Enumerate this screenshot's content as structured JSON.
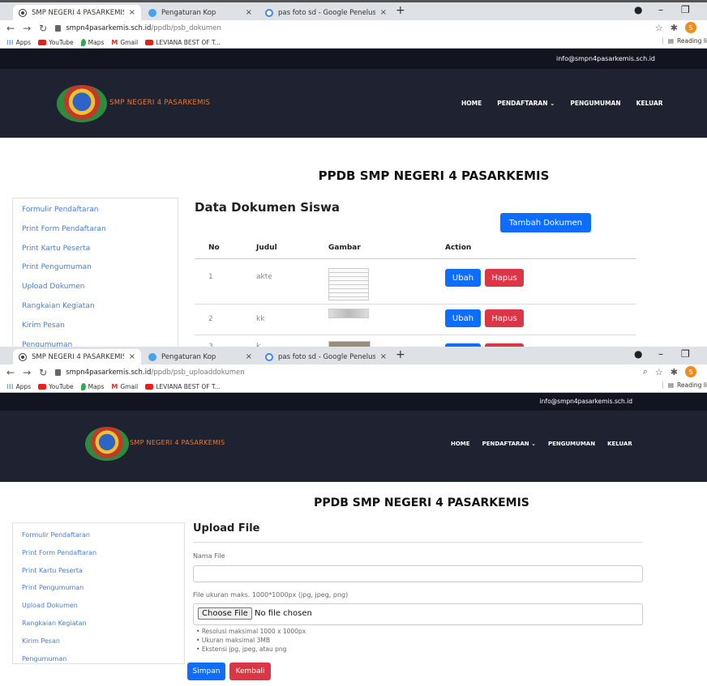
{
  "browser": {
    "tabs": [
      {
        "title": "SMP NEGERI 4 PASARKEMIS"
      },
      {
        "title": "Pengaturan Kop"
      },
      {
        "title": "pas foto sd - Google Penelusuran"
      }
    ],
    "close_glyph": "×",
    "new_tab_glyph": "+",
    "bookmarks": [
      "Apps",
      "YouTube",
      "Maps",
      "Gmail",
      "LEVIANA BEST OF T..."
    ],
    "reading_list": "Reading li",
    "profile_initial": "S",
    "icons": [
      "back-arrow-icon",
      "forward-arrow-icon",
      "reload-icon",
      "lock-icon",
      "star-icon",
      "extensions-icon",
      "profile-avatar-icon",
      "reading-list-icon"
    ]
  },
  "screen1": {
    "url_host": "smpn4pasarkemis.sch.id",
    "url_path": "/ppdb/psb_dokumen"
  },
  "screen2": {
    "url_host": "smpn4pasarkemis.sch.id",
    "url_path": "/ppdb/psb_uploaddokumen"
  },
  "site": {
    "email": "info@smpn4pasarkemis.sch.id",
    "brand": "SMP NEGERI 4 PASARKEMIS",
    "nav": [
      "HOME",
      "PENDAFTARAN ⌄",
      "PENGUMUMAN",
      "KELUAR"
    ],
    "page_heading": "PPDB SMP NEGERI 4 PASARKEMIS",
    "sidebar": [
      "Formulir Pendaftaran",
      "Print Form Pendaftaran",
      "Print Kartu Peserta",
      "Print Pengumuman",
      "Upload Dokumen",
      "Rangkaian Kegiatan",
      "Kirim Pesan",
      "Pengumuman"
    ],
    "accent_orange": "#f07a2a",
    "link_blue": "#4a7ec9",
    "btn_blue": "#0d6efd",
    "btn_red": "#dc3545"
  },
  "dokumen": {
    "title": "Data Dokumen Siswa",
    "add_button": "Tambah Dokumen",
    "columns": [
      "No",
      "Judul",
      "Gambar",
      "Action"
    ],
    "rows": [
      {
        "no": "1",
        "judul": "akte"
      },
      {
        "no": "2",
        "judul": "kk"
      },
      {
        "no": "3",
        "judul": "k"
      }
    ],
    "edit_label": "Ubah",
    "delete_label": "Hapus"
  },
  "upload": {
    "title": "Upload File",
    "name_label": "Nama File",
    "file_label": "File ukuran maks. 1000*1000px (jpg, jpeg, png)",
    "choose_button": "Choose File",
    "no_file": "No file chosen",
    "notes": [
      "Resolusi maksimal 1000 x 1000px",
      "Ukuran maksimal 3MB",
      "Ekstensi jpg, jpeg, atau png"
    ],
    "save_button": "Simpan",
    "back_button": "Kembali"
  }
}
